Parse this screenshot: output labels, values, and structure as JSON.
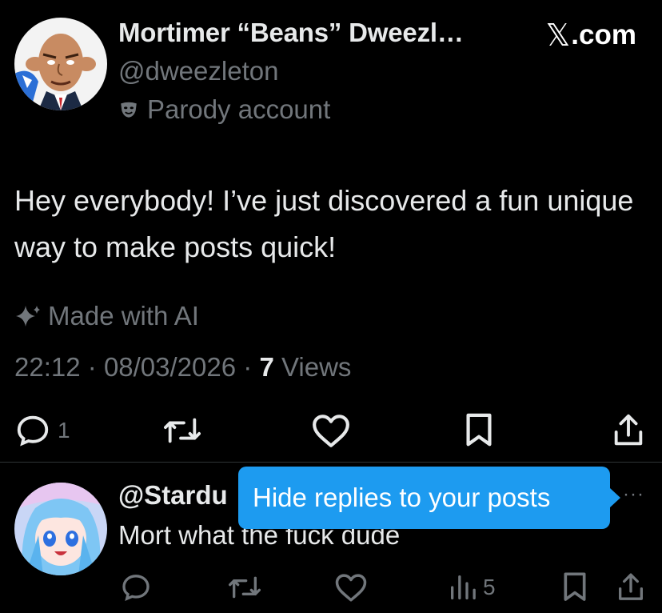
{
  "post": {
    "author_name": "Mortimer “Beans” Dweezl…",
    "handle": "@dweezleton",
    "badge_label": "Parody account",
    "text": "Hey everybody! I’ve just discovered a fun unique way to make posts quick!",
    "ai_label": "Made with AI",
    "time": "22:12",
    "date": "08/03/2026",
    "views_count": "7",
    "views_label": "Views",
    "separator": "·",
    "reply_count": "1"
  },
  "brand": {
    "label": ".com",
    "glyph": "𝕏"
  },
  "reply": {
    "handle": "@Stardu",
    "text": "Mort what the fuck dude",
    "views_count": "5",
    "more_label": "···"
  },
  "tooltip": {
    "text": "Hide replies to your posts"
  },
  "colors": {
    "background": "#000000",
    "text": "#e7e9ea",
    "muted": "#71767b",
    "accent": "#1d9bf0",
    "divider": "#2f3336"
  },
  "icons": [
    "reply-icon",
    "repost-icon",
    "like-icon",
    "bookmark-icon",
    "share-icon",
    "views-icon",
    "parody-mask-icon",
    "ai-sparkle-icon"
  ]
}
